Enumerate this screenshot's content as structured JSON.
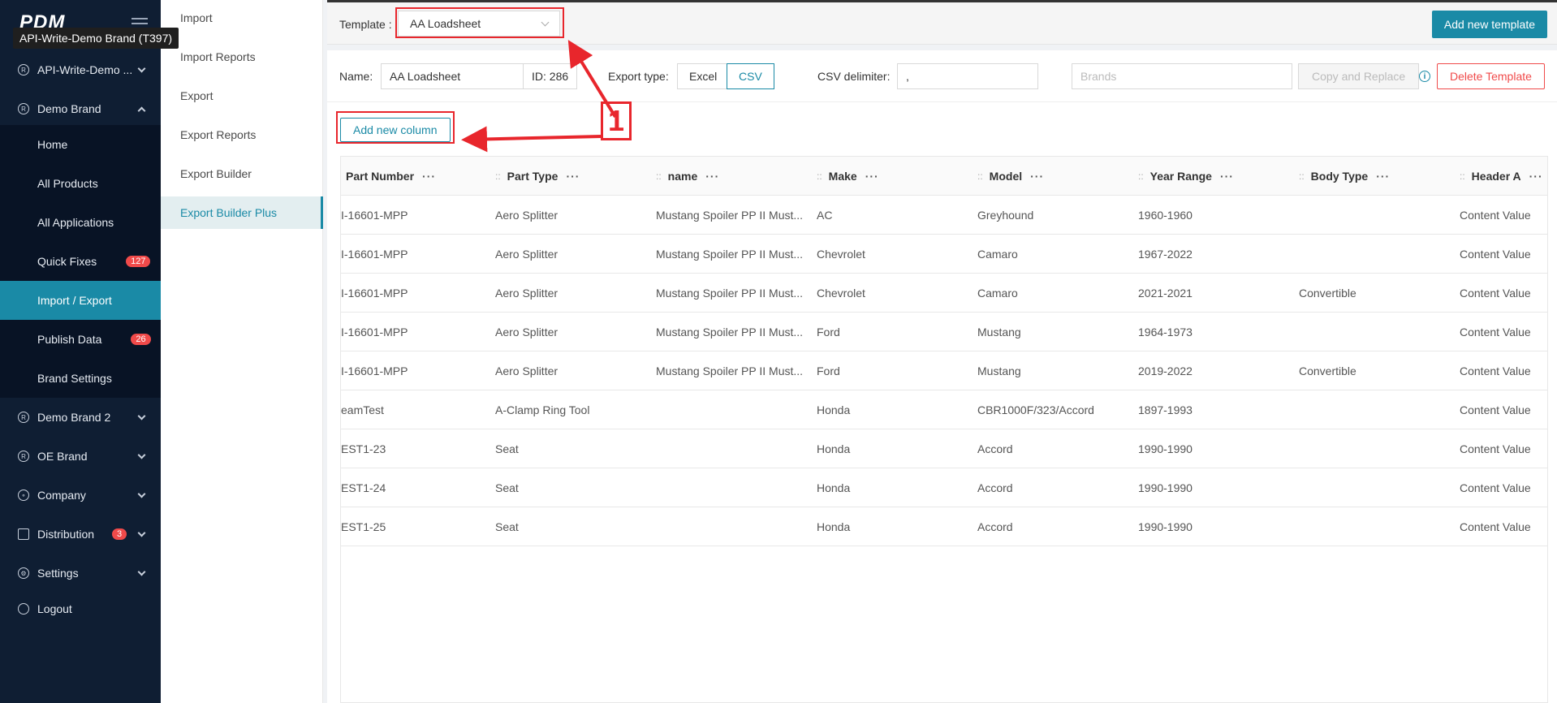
{
  "sidebar": {
    "logo": "PDM",
    "tooltip": "API-Write-Demo Brand (T397)",
    "items": [
      {
        "label": "API-Write-Demo ...",
        "icon": "registered-icon"
      },
      {
        "label": "Demo Brand",
        "icon": "registered-icon"
      },
      {
        "label": "Home"
      },
      {
        "label": "All Products"
      },
      {
        "label": "All Applications"
      },
      {
        "label": "Quick Fixes",
        "badge": "127"
      },
      {
        "label": "Import / Export"
      },
      {
        "label": "Publish Data",
        "badge": "26"
      },
      {
        "label": "Brand Settings"
      },
      {
        "label": "Demo Brand 2",
        "icon": "registered-icon"
      },
      {
        "label": "OE Brand",
        "icon": "registered-icon"
      },
      {
        "label": "Company",
        "icon": "globe-icon"
      },
      {
        "label": "Distribution",
        "icon": "distribution-icon",
        "badge": "3"
      },
      {
        "label": "Settings",
        "icon": "gear-icon"
      },
      {
        "label": "Logout",
        "icon": "logout-icon"
      }
    ]
  },
  "submenu": {
    "items": [
      "Import",
      "Import Reports",
      "Export",
      "Export Reports",
      "Export Builder",
      "Export Builder Plus"
    ]
  },
  "topbar": {
    "template_label": "Template :",
    "template_value": "AA Loadsheet",
    "add_template": "Add new template"
  },
  "form": {
    "name_label": "Name:",
    "name_value": "AA Loadsheet",
    "id_value": "ID: 286",
    "export_type_label": "Export type:",
    "export_types": [
      "Excel",
      "CSV"
    ],
    "csv_delimiter_label": "CSV delimiter:",
    "csv_delimiter_value": ",",
    "brands_placeholder": "Brands",
    "copy_replace": "Copy and Replace",
    "delete_template": "Delete Template"
  },
  "add_column": "Add new column",
  "annotation_number": "1",
  "table": {
    "headers": [
      "Part Number",
      "Part Type",
      "name",
      "Make",
      "Model",
      "Year Range",
      "Body Type",
      "Header A"
    ],
    "rows": [
      [
        "I-16601-MPP",
        "Aero Splitter",
        "Mustang Spoiler PP II Must...",
        "AC",
        "Greyhound",
        "1960-1960",
        "",
        "Content Value"
      ],
      [
        "I-16601-MPP",
        "Aero Splitter",
        "Mustang Spoiler PP II Must...",
        "Chevrolet",
        "Camaro",
        "1967-2022",
        "",
        "Content Value"
      ],
      [
        "I-16601-MPP",
        "Aero Splitter",
        "Mustang Spoiler PP II Must...",
        "Chevrolet",
        "Camaro",
        "2021-2021",
        "Convertible",
        "Content Value"
      ],
      [
        "I-16601-MPP",
        "Aero Splitter",
        "Mustang Spoiler PP II Must...",
        "Ford",
        "Mustang",
        "1964-1973",
        "",
        "Content Value"
      ],
      [
        "I-16601-MPP",
        "Aero Splitter",
        "Mustang Spoiler PP II Must...",
        "Ford",
        "Mustang",
        "2019-2022",
        "Convertible",
        "Content Value"
      ],
      [
        "eamTest",
        "A-Clamp Ring Tool",
        "",
        "Honda",
        "CBR1000F/323/Accord",
        "1897-1993",
        "",
        "Content Value"
      ],
      [
        "EST1-23",
        "Seat",
        "",
        "Honda",
        "Accord",
        "1990-1990",
        "",
        "Content Value"
      ],
      [
        "EST1-24",
        "Seat",
        "",
        "Honda",
        "Accord",
        "1990-1990",
        "",
        "Content Value"
      ],
      [
        "EST1-25",
        "Seat",
        "",
        "Honda",
        "Accord",
        "1990-1990",
        "",
        "Content Value"
      ]
    ]
  }
}
